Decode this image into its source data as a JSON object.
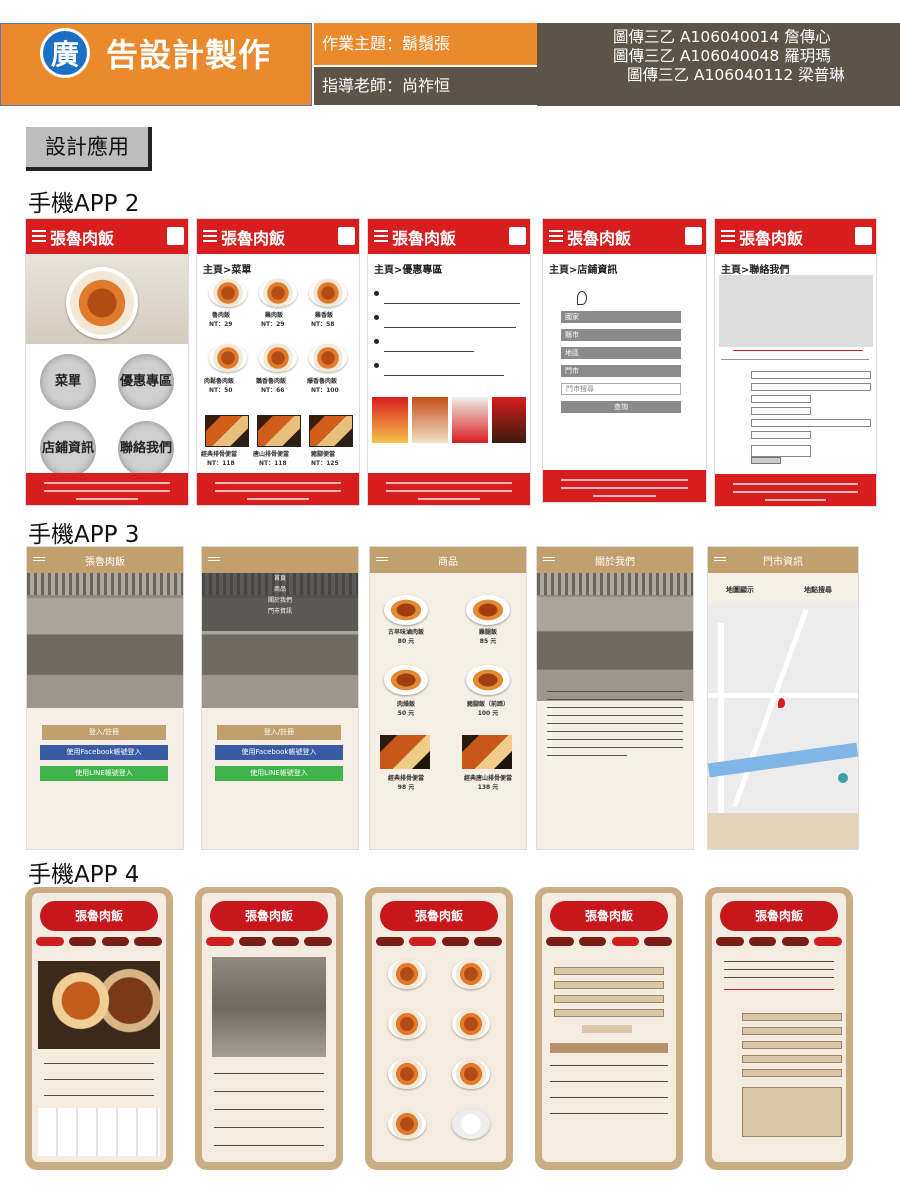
{
  "header": {
    "logo_char": "廣",
    "logo_rest": "告設計製作",
    "theme": "作業主題：鬍鬚張",
    "teacher": "指導老師：尚祚恒",
    "members": [
      "圖傳三乙 A106040014 詹傳心",
      "圖傳三乙 A106040048 羅玥瑪",
      "圖傳三乙 A106040112 梁普琳"
    ]
  },
  "section": "設計應用",
  "rows": {
    "app2": "手機APP 2",
    "app3": "手機APP 3",
    "app4": "手機APP 4"
  },
  "app2": {
    "brand": "張魯肉飯",
    "circles": [
      "菜單",
      "優惠專區",
      "店鋪資訊",
      "聯絡我們"
    ],
    "crumb_menu": "主頁>菜單",
    "crumb_promo": "主頁>優惠專區",
    "crumb_store": "主頁>店鋪資訊",
    "crumb_contact": "主頁>聯絡我們",
    "menu_items": [
      {
        "name": "魯肉飯",
        "price": "NT：29"
      },
      {
        "name": "雞肉飯",
        "price": "NT：29"
      },
      {
        "name": "雞香飯",
        "price": "NT：58"
      },
      {
        "name": "肉鬆魯肉飯",
        "price": "NT：50"
      },
      {
        "name": "鵝香魯肉飯",
        "price": "NT：66"
      },
      {
        "name": "爆香魯肉飯",
        "price": "NT：100"
      },
      {
        "name": "經典排骨便當",
        "price": "NT：118"
      },
      {
        "name": "唐山排骨便當",
        "price": "NT：118"
      },
      {
        "name": "豬腳便當",
        "price": "NT：125"
      }
    ],
    "store_fields": [
      "國家",
      "縣市",
      "地區",
      "門市",
      "門市搜尋"
    ],
    "store_btn": "查詢"
  },
  "app3": {
    "titles": [
      "張魯肉飯",
      "",
      "商品",
      "關於我們",
      "門市資訊"
    ],
    "login": "登入/註冊",
    "fb": "使用Facebook帳號登入",
    "line": "使用LINE帳號登入",
    "menu": [
      "首頁",
      "商品",
      "關於我們",
      "門市資訊"
    ],
    "products": [
      {
        "name": "古早味滷肉飯",
        "price": "80 元"
      },
      {
        "name": "雞腿飯",
        "price": "85 元"
      },
      {
        "name": "肉燥飯",
        "price": "50 元"
      },
      {
        "name": "豬腳飯（前蹄）",
        "price": "100 元"
      },
      {
        "name": "經典排骨便當",
        "price": "98 元"
      },
      {
        "name": "經典唐山排骨便當",
        "price": "138 元"
      }
    ],
    "map_tabs": [
      "地圖顯示",
      "地點搜尋"
    ]
  },
  "app4": {
    "brand": "張魯肉飯"
  }
}
